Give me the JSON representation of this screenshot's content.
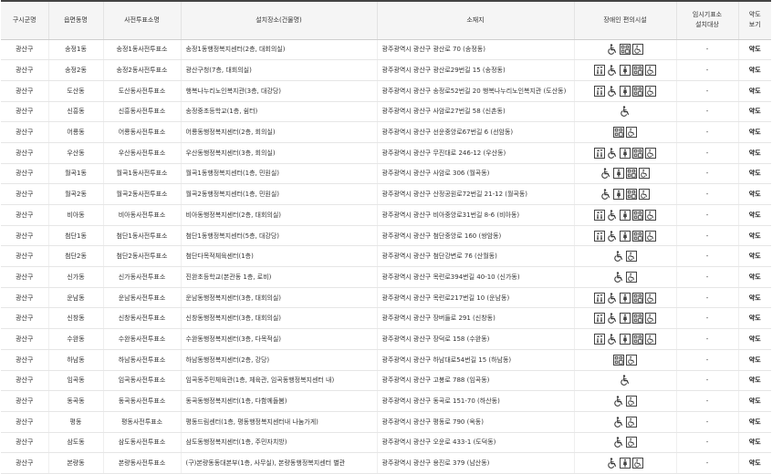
{
  "headers": [
    "구시군명",
    "읍면동명",
    "사전투표소명",
    "설치장소(건물명)",
    "소재지",
    "장애인 편의시설",
    "임시기표소\n설치대상",
    "약도\n보기"
  ],
  "icon_legend": {
    "elevator": "elevator-icon",
    "wheelchair": "wheelchair-icon",
    "restroom": "accessible-restroom-icon",
    "braille": "braille-guide-icon",
    "ramp": "ramp-icon"
  },
  "rows": [
    {
      "gu": "광산구",
      "dong": "송정1동",
      "station": "송정1동사전투표소",
      "place": "송정1동행정복지센터(2층, 대회의실)",
      "addr": "광주광역시 광산구 광산로 70 (송정동)",
      "icons": [
        "wheelchair",
        "braille",
        "ramp"
      ],
      "temp": "-",
      "map": "약도"
    },
    {
      "gu": "광산구",
      "dong": "송정2동",
      "station": "송정2동사전투표소",
      "place": "광산구청(7층, 대회의실)",
      "addr": "광주광역시 광산구 광산로29번길 15 (송정동)",
      "icons": [
        "elevator",
        "wheelchair",
        "restroom",
        "braille",
        "ramp"
      ],
      "temp": "-",
      "map": "약도"
    },
    {
      "gu": "광산구",
      "dong": "도산동",
      "station": "도산동사전투표소",
      "place": "행복나누리노인복지관(3층, 대강당)",
      "addr": "광주광역시 광산구 송정로52번길 20 행복나누리노인복지관 (도산동)",
      "icons": [
        "elevator",
        "wheelchair",
        "restroom",
        "braille",
        "ramp"
      ],
      "temp": "-",
      "map": "약도"
    },
    {
      "gu": "광산구",
      "dong": "신흥동",
      "station": "신흥동사전투표소",
      "place": "송정중초등학교(1층, 쉼터)",
      "addr": "광주광역시 광산구 사암로27번길 58 (신촌동)",
      "icons": [
        "wheelchair"
      ],
      "temp": "-",
      "map": "약도"
    },
    {
      "gu": "광산구",
      "dong": "어룡동",
      "station": "어룡동사전투표소",
      "place": "어룡동행정복지센터(2층, 회의실)",
      "addr": "광주광역시 광산구 선운중앙로67번길 6 (선암동)",
      "icons": [
        "braille",
        "ramp"
      ],
      "temp": "-",
      "map": "약도"
    },
    {
      "gu": "광산구",
      "dong": "우산동",
      "station": "우산동사전투표소",
      "place": "우산동행정복지센터(3층, 회의실)",
      "addr": "광주광역시 광산구 무진대로 246-12 (우산동)",
      "icons": [
        "elevator",
        "wheelchair",
        "restroom",
        "braille",
        "ramp"
      ],
      "temp": "-",
      "map": "약도"
    },
    {
      "gu": "광산구",
      "dong": "월곡1동",
      "station": "월곡1동사전투표소",
      "place": "월곡1동행정복지센터(1층, 민원실)",
      "addr": "광주광역시 광산구 사암로 306 (월곡동)",
      "icons": [
        "wheelchair",
        "restroom",
        "braille",
        "ramp"
      ],
      "temp": "-",
      "map": "약도"
    },
    {
      "gu": "광산구",
      "dong": "월곡2동",
      "station": "월곡2동사전투표소",
      "place": "월곡2동행정복지센터(1층, 민원실)",
      "addr": "광주광역시 광산구 산정공원로72번길 21-12 (월곡동)",
      "icons": [
        "wheelchair",
        "restroom",
        "braille",
        "ramp"
      ],
      "temp": "-",
      "map": "약도"
    },
    {
      "gu": "광산구",
      "dong": "비아동",
      "station": "비아동사전투표소",
      "place": "비아동행정복지센터(2층, 대회의실)",
      "addr": "광주광역시 광산구 비아중앙로31번길 8-6 (비아동)",
      "icons": [
        "elevator",
        "wheelchair",
        "restroom",
        "braille",
        "ramp"
      ],
      "temp": "-",
      "map": "약도"
    },
    {
      "gu": "광산구",
      "dong": "첨단1동",
      "station": "첨단1동사전투표소",
      "place": "첨단1동행정복지센터(5층, 대강당)",
      "addr": "광주광역시 광산구 첨단중앙로 160 (쌍암동)",
      "icons": [
        "elevator",
        "wheelchair",
        "restroom",
        "braille",
        "ramp"
      ],
      "temp": "-",
      "map": "약도"
    },
    {
      "gu": "광산구",
      "dong": "첨단2동",
      "station": "첨단2동사전투표소",
      "place": "첨단다목적체육센터(1층)",
      "addr": "광주광역시 광산구 첨단강변로 76 (산월동)",
      "icons": [
        "wheelchair",
        "ramp"
      ],
      "temp": "-",
      "map": "약도"
    },
    {
      "gu": "광산구",
      "dong": "신가동",
      "station": "신가동사전투표소",
      "place": "진완초등학교(본관동 1층, 로비)",
      "addr": "광주광역시 광산구 목련로394번길 40-10 (신가동)",
      "icons": [
        "wheelchair",
        "ramp"
      ],
      "temp": "-",
      "map": "약도"
    },
    {
      "gu": "광산구",
      "dong": "운남동",
      "station": "운남동사전투표소",
      "place": "운남동행정복지센터(3층, 대회의실)",
      "addr": "광주광역시 광산구 목련로217번길 10 (운남동)",
      "icons": [
        "elevator",
        "wheelchair",
        "restroom",
        "braille",
        "ramp"
      ],
      "temp": "-",
      "map": "약도"
    },
    {
      "gu": "광산구",
      "dong": "신창동",
      "station": "신창동사전투표소",
      "place": "신창동행정복지센터(3층, 대회의실)",
      "addr": "광주광역시 광산구 장버들로 291 (신창동)",
      "icons": [
        "elevator",
        "wheelchair",
        "restroom",
        "braille",
        "ramp"
      ],
      "temp": "-",
      "map": "약도"
    },
    {
      "gu": "광산구",
      "dong": "수완동",
      "station": "수완동사전투표소",
      "place": "수완동행정복지센터(3층, 다목적실)",
      "addr": "광주광역시 광산구 장덕로 158 (수완동)",
      "icons": [
        "elevator",
        "wheelchair",
        "restroom",
        "braille",
        "ramp"
      ],
      "temp": "-",
      "map": "약도"
    },
    {
      "gu": "광산구",
      "dong": "하남동",
      "station": "하남동사전투표소",
      "place": "하남동행정복지센터(2층, 강당)",
      "addr": "광주광역시 광산구 하남대로54번길 15 (하남동)",
      "icons": [
        "braille",
        "ramp"
      ],
      "temp": "-",
      "map": "약도"
    },
    {
      "gu": "광산구",
      "dong": "임곡동",
      "station": "임곡동사전투표소",
      "place": "임곡동주민체육관(1층, 체육관, 임곡동행정복지센터 내)",
      "addr": "광주광역시 광산구 고봉로 788 (임곡동)",
      "icons": [
        "wheelchair"
      ],
      "temp": "-",
      "map": "약도"
    },
    {
      "gu": "광산구",
      "dong": "동곡동",
      "station": "동곡동사전투표소",
      "place": "동곡동행정복지센터(1층, 다함께돌봄)",
      "addr": "광주광역시 광산구 동곡로 151-70 (하산동)",
      "icons": [
        "wheelchair",
        "ramp"
      ],
      "temp": "-",
      "map": "약도"
    },
    {
      "gu": "광산구",
      "dong": "평동",
      "station": "평동사전투표소",
      "place": "평동드림센터(1층, 평동행정복지센터내 나눔가게)",
      "addr": "광주광역시 광산구 평동로 790 (옥동)",
      "icons": [
        "wheelchair",
        "ramp"
      ],
      "temp": "-",
      "map": "약도"
    },
    {
      "gu": "광산구",
      "dong": "삼도동",
      "station": "삼도동사전투표소",
      "place": "삼도동행정복지센터(1층, 주민자치방)",
      "addr": "광주광역시 광산구 오운로 433-1 (도덕동)",
      "icons": [
        "wheelchair",
        "ramp"
      ],
      "temp": "-",
      "map": "약도"
    },
    {
      "gu": "광산구",
      "dong": "본량동",
      "station": "본량동사전투표소",
      "place": "(구)본량동동대본부(1층, 사무실), 본량동행정복지센터 별관",
      "addr": "광주광역시 광산구 용진로 379 (남산동)",
      "icons": [
        "wheelchair",
        "restroom",
        "ramp"
      ],
      "temp": "-",
      "map": "약도"
    }
  ]
}
